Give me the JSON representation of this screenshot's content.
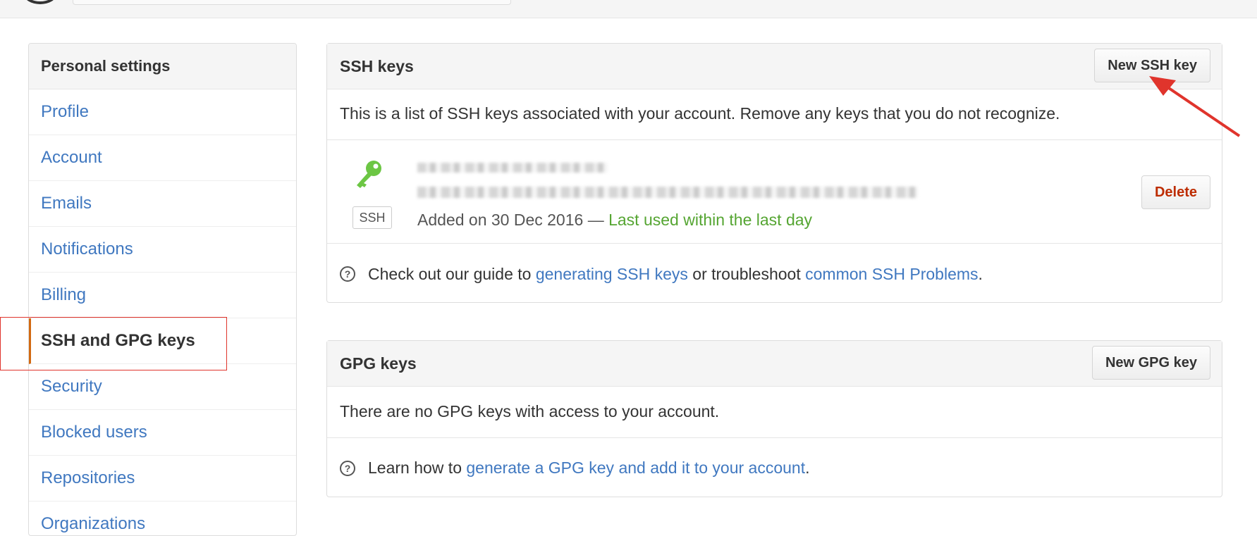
{
  "colors": {
    "link": "#4078c0",
    "accent": "#d26911",
    "annotation": "#e0342c",
    "danger": "#bd2c00",
    "success": "#55a532"
  },
  "sidebar": {
    "heading": "Personal settings",
    "items": [
      {
        "label": "Profile"
      },
      {
        "label": "Account"
      },
      {
        "label": "Emails"
      },
      {
        "label": "Notifications"
      },
      {
        "label": "Billing"
      },
      {
        "label": "SSH and GPG keys",
        "selected": true
      },
      {
        "label": "Security"
      },
      {
        "label": "Blocked users"
      },
      {
        "label": "Repositories"
      },
      {
        "label": "Organizations"
      }
    ]
  },
  "ssh": {
    "title": "SSH keys",
    "new_button": "New SSH key",
    "description": "This is a list of SSH keys associated with your account. Remove any keys that you do not recognize.",
    "key": {
      "badge": "SSH",
      "added_prefix": "Added on 30 Dec 2016 — ",
      "last_used": "Last used within the last day",
      "delete_label": "Delete"
    },
    "help": {
      "prefix": "Check out our guide to ",
      "link1": "generating SSH keys",
      "middle": " or troubleshoot ",
      "link2": "common SSH Problems",
      "suffix": "."
    }
  },
  "gpg": {
    "title": "GPG keys",
    "new_button": "New GPG key",
    "empty_text": "There are no GPG keys with access to your account.",
    "help": {
      "prefix": "Learn how to ",
      "link": "generate a GPG key and add it to your account",
      "suffix": "."
    }
  },
  "icons": {
    "help": "question-circle-icon",
    "key": "key-icon",
    "logo": "github-logo-icon"
  }
}
